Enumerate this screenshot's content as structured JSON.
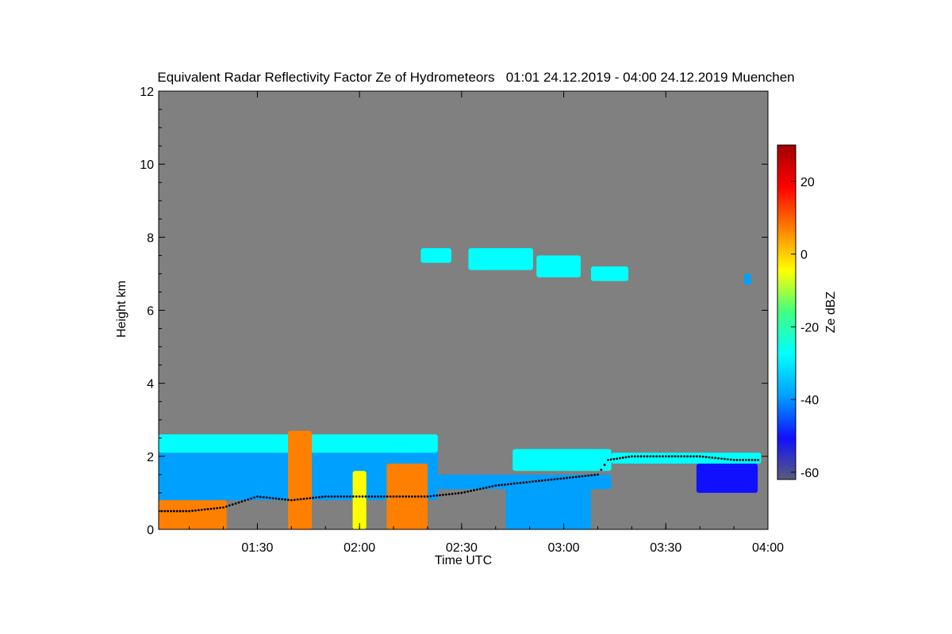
{
  "chart_data": {
    "type": "heatmap",
    "title": "Equivalent Radar Reflectivity Factor Ze of Hydrometeors   01:01 24.12.2019 - 04:00 24.12.2019 Muenchen",
    "xlabel": "Time UTC",
    "ylabel": "Height km",
    "colorbar_label": "Ze dBZ",
    "xlim": [
      "01:01",
      "04:00"
    ],
    "ylim": [
      0,
      12
    ],
    "x_ticks": [
      "01:30",
      "02:00",
      "02:30",
      "03:00",
      "03:30",
      "04:00"
    ],
    "y_ticks": [
      0,
      2,
      4,
      6,
      8,
      10,
      12
    ],
    "colorbar_range": [
      -62,
      30
    ],
    "colorbar_ticks": [
      20,
      0,
      -20,
      -40,
      -60
    ],
    "background_color": "#808080",
    "colormap": [
      "#5a5a7a",
      "#1010ff",
      "#00a0ff",
      "#00ffff",
      "#40ff80",
      "#ffff00",
      "#ff8000",
      "#ff0000",
      "#a00000"
    ],
    "echo_regions": [
      {
        "t0": "01:01",
        "t1": "01:21",
        "h0": 0.0,
        "h1": 0.8,
        "dbz": 5
      },
      {
        "t0": "01:01",
        "t1": "02:23",
        "h0": 0.8,
        "h1": 2.5,
        "dbz": -40
      },
      {
        "t0": "01:01",
        "t1": "02:23",
        "h0": 2.1,
        "h1": 2.6,
        "dbz": -25
      },
      {
        "t0": "01:39",
        "t1": "01:46",
        "h0": 0.0,
        "h1": 2.7,
        "dbz": 10
      },
      {
        "t0": "01:58",
        "t1": "02:02",
        "h0": 0.0,
        "h1": 1.6,
        "dbz": 0
      },
      {
        "t0": "02:08",
        "t1": "02:20",
        "h0": 0.0,
        "h1": 1.8,
        "dbz": 5
      },
      {
        "t0": "02:23",
        "t1": "03:14",
        "h0": 1.1,
        "h1": 1.5,
        "dbz": -40
      },
      {
        "t0": "02:45",
        "t1": "03:14",
        "h0": 1.6,
        "h1": 2.2,
        "dbz": -25
      },
      {
        "t0": "02:43",
        "t1": "03:08",
        "h0": 0.0,
        "h1": 1.2,
        "dbz": -42
      },
      {
        "t0": "03:14",
        "t1": "03:58",
        "h0": 1.8,
        "h1": 2.1,
        "dbz": -28
      },
      {
        "t0": "03:39",
        "t1": "03:57",
        "h0": 1.0,
        "h1": 1.8,
        "dbz": -45
      },
      {
        "t0": "02:18",
        "t1": "02:27",
        "h0": 7.3,
        "h1": 7.7,
        "dbz": -28
      },
      {
        "t0": "02:32",
        "t1": "02:51",
        "h0": 7.1,
        "h1": 7.7,
        "dbz": -25
      },
      {
        "t0": "02:52",
        "t1": "03:05",
        "h0": 6.9,
        "h1": 7.5,
        "dbz": -28
      },
      {
        "t0": "03:08",
        "t1": "03:19",
        "h0": 6.8,
        "h1": 7.2,
        "dbz": -30
      },
      {
        "t0": "03:53",
        "t1": "03:55",
        "h0": 6.7,
        "h1": 7.0,
        "dbz": -40
      }
    ],
    "cloud_base": {
      "t": [
        "01:01",
        "01:10",
        "01:20",
        "01:30",
        "01:40",
        "01:50",
        "02:00",
        "02:10",
        "02:20",
        "02:30",
        "02:40",
        "02:50",
        "03:00",
        "03:10",
        "03:13",
        "03:20",
        "03:30",
        "03:40",
        "03:50",
        "03:58"
      ],
      "h": [
        0.5,
        0.5,
        0.6,
        0.9,
        0.8,
        0.9,
        0.9,
        0.9,
        0.9,
        1.0,
        1.2,
        1.3,
        1.4,
        1.5,
        1.9,
        2.0,
        2.0,
        2.0,
        1.9,
        1.9
      ]
    }
  }
}
